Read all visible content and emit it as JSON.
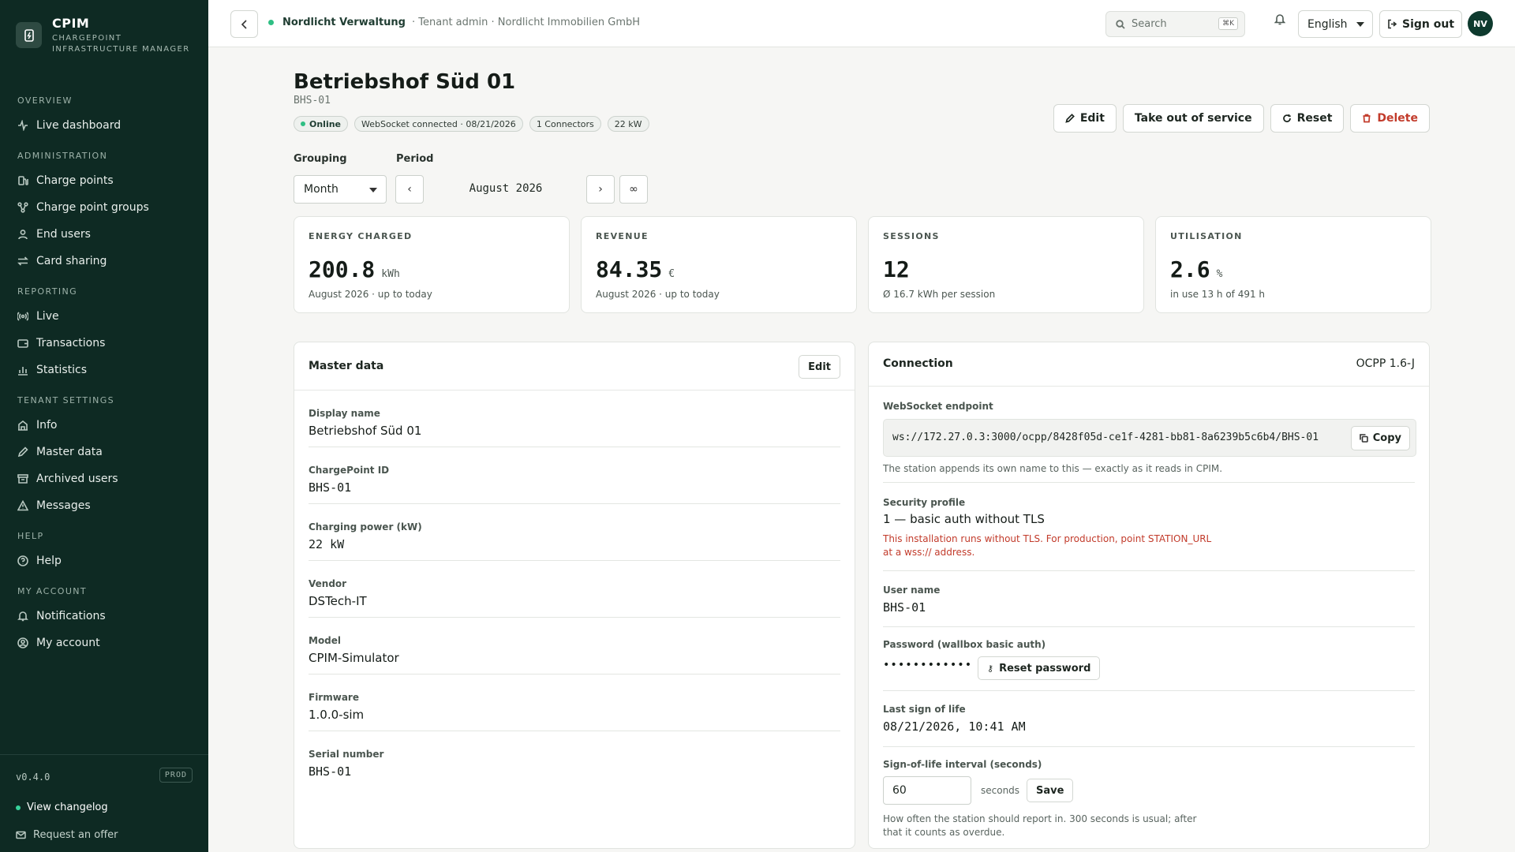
{
  "brand": {
    "name": "CPIM",
    "subtitle_line1": "CHARGEPOINT",
    "subtitle_line2": "INFRASTRUCTURE MANAGER"
  },
  "sidebar": {
    "sections": [
      {
        "title": "OVERVIEW",
        "items": [
          {
            "label": "Live dashboard",
            "icon": "activity-icon"
          }
        ]
      },
      {
        "title": "ADMINISTRATION",
        "items": [
          {
            "label": "Charge points",
            "icon": "fuel-pump-icon"
          },
          {
            "label": "Charge point groups",
            "icon": "network-icon"
          },
          {
            "label": "End users",
            "icon": "user-icon"
          },
          {
            "label": "Card sharing",
            "icon": "arrows-icon"
          }
        ]
      },
      {
        "title": "REPORTING",
        "items": [
          {
            "label": "Live",
            "icon": "radio-icon"
          },
          {
            "label": "Transactions",
            "icon": "wallet-icon"
          },
          {
            "label": "Statistics",
            "icon": "bar-chart-icon"
          }
        ]
      },
      {
        "title": "TENANT SETTINGS",
        "items": [
          {
            "label": "Info",
            "icon": "building-icon"
          },
          {
            "label": "Master data",
            "icon": "pencil-icon"
          },
          {
            "label": "Archived users",
            "icon": "archive-icon"
          },
          {
            "label": "Messages",
            "icon": "alert-icon"
          }
        ]
      },
      {
        "title": "HELP",
        "items": [
          {
            "label": "Help",
            "icon": "help-icon"
          }
        ]
      },
      {
        "title": "MY ACCOUNT",
        "items": [
          {
            "label": "Notifications",
            "icon": "bell-icon"
          },
          {
            "label": "My account",
            "icon": "user-circle-icon"
          }
        ]
      }
    ],
    "version": "v0.4.0",
    "env": "PROD",
    "changelog": "View changelog",
    "offer": "Request an offer"
  },
  "topbar": {
    "tenant_name": "Nordlicht Verwaltung",
    "tenant_meta": "· Tenant admin · Nordlicht Immobilien GmbH",
    "search_placeholder": "Search",
    "shortcut": "⌘K",
    "language": "English",
    "sign_out": "Sign out",
    "avatar": "NV"
  },
  "header": {
    "title": "Betriebshof Süd 01",
    "subtitle": "BHS-01",
    "badges": {
      "status": "Online",
      "ws": "WebSocket connected · 08/21/2026",
      "connectors": "1 Connectors",
      "power": "22 kW"
    },
    "actions": {
      "edit": "Edit",
      "out_of_service": "Take out of service",
      "reset": "Reset",
      "delete": "Delete"
    }
  },
  "filters": {
    "grouping_label": "Grouping",
    "grouping_value": "Month",
    "period_label": "Period",
    "period_value": "August 2026",
    "prev": "‹",
    "next": "›",
    "all": "∞"
  },
  "kpis": [
    {
      "title": "ENERGY CHARGED",
      "value": "200.8",
      "unit": "kWh",
      "sub": "August 2026 · up to today"
    },
    {
      "title": "REVENUE",
      "value": "84.35",
      "unit": "€",
      "sub": "August 2026 · up to today"
    },
    {
      "title": "SESSIONS",
      "value": "12",
      "unit": "",
      "sub": "Ø 16.7 kWh per session"
    },
    {
      "title": "UTILISATION",
      "value": "2.6",
      "unit": "%",
      "sub": "in use 13 h of 491 h"
    }
  ],
  "master": {
    "title": "Master data",
    "edit": "Edit",
    "fields": [
      {
        "label": "Display name",
        "value": "Betriebshof Süd 01"
      },
      {
        "label": "ChargePoint ID",
        "value": "BHS-01"
      },
      {
        "label": "Charging power (kW)",
        "value": "22 kW"
      },
      {
        "label": "Vendor",
        "value": "DSTech-IT"
      },
      {
        "label": "Model",
        "value": "CPIM-Simulator"
      },
      {
        "label": "Firmware",
        "value": "1.0.0-sim"
      },
      {
        "label": "Serial number",
        "value": "BHS-01"
      }
    ]
  },
  "connection": {
    "title": "Connection",
    "protocol": "OCPP 1.6-J",
    "ws_label": "WebSocket endpoint",
    "ws_value": "ws://172.27.0.3:3000/ocpp/8428f05d-ce1f-4281-bb81-8a6239b5c6b4/BHS-01",
    "copy": "Copy",
    "ws_hint": "The station appends its own name to this — exactly as it reads in CPIM.",
    "security_label": "Security profile",
    "security_value": "1 — basic auth without TLS",
    "security_warning": "This installation runs without TLS. For production, point STATION_URL at a wss:// address.",
    "user_label": "User name",
    "user_value": "BHS-01",
    "password_label": "Password (wallbox basic auth)",
    "password_value": "••••••••••••",
    "reset_password": "Reset password",
    "last_label": "Last sign of life",
    "last_value": "08/21/2026, 10:41 AM",
    "interval_label": "Sign-of-life interval (seconds)",
    "interval_value": "60",
    "interval_unit": "seconds",
    "save": "Save",
    "interval_hint": "How often the station should report in. 300 seconds is usual; after that it counts as overdue."
  }
}
